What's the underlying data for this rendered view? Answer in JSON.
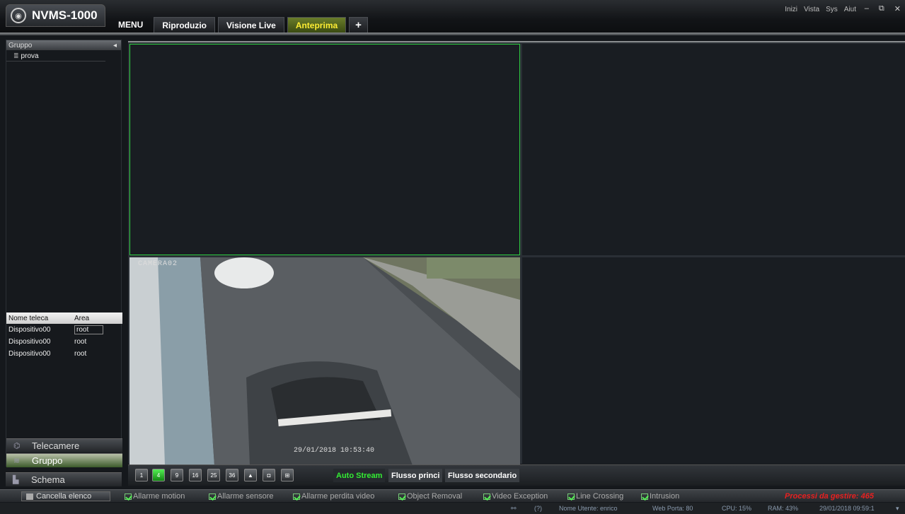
{
  "app": {
    "title": "NVMS-1000"
  },
  "tabs": [
    {
      "label": "MENU"
    },
    {
      "label": "Riproduzio"
    },
    {
      "label": "Visione Live"
    },
    {
      "label": "Anteprima"
    },
    {
      "label": "+"
    }
  ],
  "system_menu": [
    "Inizi",
    "Vista",
    "Sys",
    "Aiut"
  ],
  "window_controls": {
    "minimize": "–",
    "restore": "⧉",
    "close": "✕"
  },
  "sidebar": {
    "group_header": "Gruppo",
    "tree_items": [
      {
        "label": "prova"
      }
    ],
    "camera_table": {
      "headers": [
        "Nome teleca",
        "Area"
      ],
      "rows": [
        [
          "Dispositivo00",
          "root"
        ],
        [
          "Dispositivo00",
          "root"
        ],
        [
          "Dispositivo00",
          "root"
        ]
      ]
    },
    "nav": [
      {
        "label": "Telecamere",
        "icon": "camera-icon"
      },
      {
        "label": "Gruppo",
        "icon": "group-icon"
      },
      {
        "label": "Schema",
        "icon": "schema-icon"
      }
    ]
  },
  "video": {
    "camera_name": "CAMERA02",
    "timestamp": "29/01/2018 10:53:40"
  },
  "toolbar": {
    "layouts": [
      "1",
      "4",
      "9",
      "16",
      "25",
      "36",
      "fullscreen",
      "snapshot",
      "grid"
    ],
    "streams": [
      "Auto Stream",
      "Flusso princi",
      "Flusso secondario"
    ]
  },
  "alarm_bar": {
    "clear_label": "Cancella elenco",
    "filters": [
      "Allarme motion",
      "Allarme sensore",
      "Allarme perdita video",
      "Object Removal",
      "Video Exception",
      "Line Crossing",
      "Intrusion"
    ],
    "pending": "Processi da gestire: 465"
  },
  "status": {
    "user": "Nome Utente: enrico",
    "web_port": "Web Porta: 80",
    "cpu": "CPU: 15%",
    "ram": "RAM: 43%",
    "datetime": "29/01/2018 09:59:1"
  },
  "colors": {
    "accent_green": "#2ecc40",
    "active_tab": "#ffee33",
    "pending_red": "#e82020"
  }
}
